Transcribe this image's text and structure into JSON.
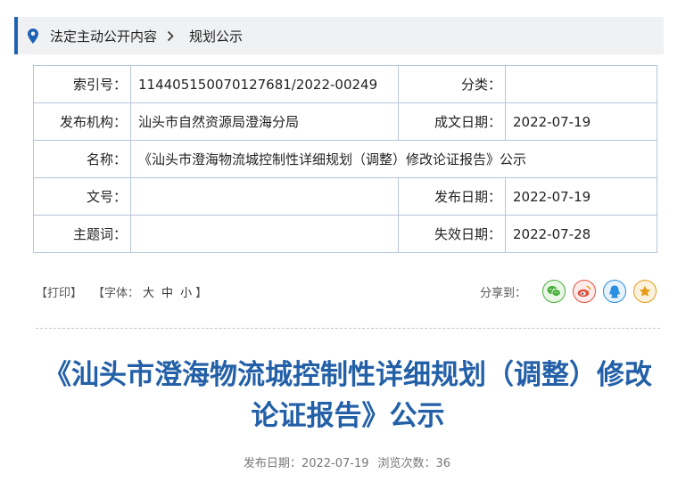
{
  "breadcrumb": {
    "home": "法定主动公开内容",
    "current": "规划公示"
  },
  "info": {
    "index_label": "索引号：",
    "index_value": "114405150070127681/2022-00249",
    "category_label": "分类：",
    "category_value": "",
    "publisher_label": "发布机构：",
    "publisher_value": "汕头市自然资源局澄海分局",
    "created_label": "成文日期：",
    "created_value": "2022-07-19",
    "name_label": "名称：",
    "name_value": "《汕头市澄海物流城控制性详细规划（调整）修改论证报告》公示",
    "docno_label": "文号：",
    "docno_value": "",
    "published_label": "发布日期：",
    "published_value": "2022-07-19",
    "subject_label": "主题词：",
    "subject_value": "",
    "expiry_label": "失效日期：",
    "expiry_value": "2022-07-28"
  },
  "tools": {
    "print": "【打印】",
    "font_prefix": "【字体：",
    "font_large": "大",
    "font_medium": "中",
    "font_small": "小",
    "font_suffix": "】"
  },
  "share": {
    "label": "分享到：",
    "icons": [
      "wechat-icon",
      "weibo-icon",
      "qq-icon",
      "favorite-icon"
    ]
  },
  "article": {
    "title": "《汕头市澄海物流城控制性详细规划（调整）修改论证报告》公示",
    "publish_label": "发布日期：",
    "publish_date": "2022-07-19",
    "views_label": "浏览次数：",
    "views": "36"
  },
  "colors": {
    "accent": "#1f62b3",
    "title": "#2360a8",
    "table_border": "#b8c6d8"
  }
}
